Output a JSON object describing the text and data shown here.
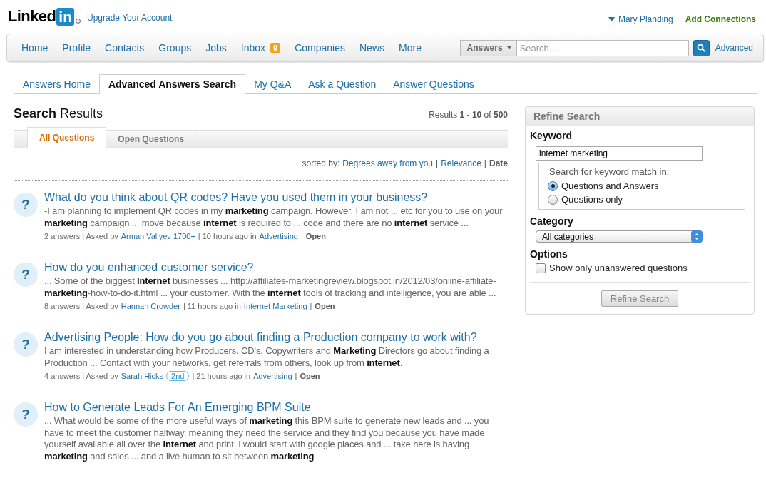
{
  "header": {
    "logo": {
      "text": "Linked",
      "badge": "in"
    },
    "upgrade_link": "Upgrade Your Account",
    "user": "Mary Planding",
    "add_connections": "Add Connections"
  },
  "nav": {
    "items": [
      {
        "label": "Home"
      },
      {
        "label": "Profile"
      },
      {
        "label": "Contacts"
      },
      {
        "label": "Groups"
      },
      {
        "label": "Jobs"
      },
      {
        "label": "Inbox",
        "badge": "9"
      },
      {
        "label": "Companies"
      },
      {
        "label": "News"
      },
      {
        "label": "More"
      }
    ],
    "search": {
      "scope": "Answers",
      "placeholder": "Search..."
    },
    "advanced_link": "Advanced"
  },
  "subtabs": [
    {
      "label": "Answers Home",
      "selected": false
    },
    {
      "label": "Advanced Answers Search",
      "selected": true
    },
    {
      "label": "My Q&A",
      "selected": false
    },
    {
      "label": "Ask a Question",
      "selected": false
    },
    {
      "label": "Answer Questions",
      "selected": false
    }
  ],
  "results": {
    "heading": "**Search** Results",
    "summary": "Results **1** - **10** of **500**",
    "tabs": [
      {
        "label": "All Questions",
        "selected": true
      },
      {
        "label": "Open Questions",
        "selected": false
      }
    ],
    "sort": [
      {
        "kind": "text",
        "text": "sorted by:"
      },
      {
        "kind": "link",
        "text": "Degrees away from you"
      },
      {
        "kind": "text",
        "text": "|"
      },
      {
        "kind": "link",
        "text": "Relevance"
      },
      {
        "kind": "text",
        "text": "|"
      },
      {
        "kind": "bold",
        "text": "Date"
      }
    ],
    "items": [
      {
        "icon": "?",
        "title": "What do you think about QR codes? Have you used them in your business?",
        "snippet": "-I am planning to implement QR codes in my **marketing** campaign. However, I am not ... etc for you to use on your **marketing** campaign ... move because **internet** is required to ... code and there are no **internet** service ...",
        "meta": [
          {
            "kind": "text",
            "text": "2 answers | Asked by"
          },
          {
            "kind": "link",
            "text": "Arman Valiyev 1700+"
          },
          {
            "kind": "text",
            "text": "| 10 hours ago in"
          },
          {
            "kind": "link",
            "text": "Advertising"
          },
          {
            "kind": "text",
            "text": "|"
          },
          {
            "kind": "bold",
            "text": "Open"
          }
        ]
      },
      {
        "icon": "?",
        "title": "How do you enhanced customer service?",
        "snippet": "... Some of the biggest **Internet** businesses ... http://affiliates-marketingreview.blogspot.in/2012/03/online-affiliate-**marketing**-how-to-do-it.html ... your customer. With the **internet** tools of tracking and intelligence, you are able ...",
        "meta": [
          {
            "kind": "text",
            "text": "8 answers | Asked by"
          },
          {
            "kind": "link",
            "text": "Hannah Crowder"
          },
          {
            "kind": "text",
            "text": "| 11 hours ago in"
          },
          {
            "kind": "link",
            "text": "Internet Marketing"
          },
          {
            "kind": "text",
            "text": "|"
          },
          {
            "kind": "bold",
            "text": "Open"
          }
        ]
      },
      {
        "icon": "?",
        "title": "Advertising People: How do you go about finding a Production company to work with?",
        "snippet": "I am interested in understanding how Producers, CD's, Copywriters and **Marketing** Directors go about finding a Production ... Contact with your networks, get referrals from others, look up from **internet**.",
        "meta": [
          {
            "kind": "text",
            "text": "4 answers | Asked by"
          },
          {
            "kind": "link",
            "text": "Sarah Hicks"
          },
          {
            "kind": "badge",
            "text": "2nd"
          },
          {
            "kind": "text",
            "text": "| 21 hours ago in"
          },
          {
            "kind": "link",
            "text": "Advertising"
          },
          {
            "kind": "text",
            "text": "|"
          },
          {
            "kind": "bold",
            "text": "Open"
          }
        ]
      },
      {
        "icon": "?",
        "title": "How to Generate Leads For An Emerging BPM Suite",
        "snippet": "... What would be some of the more useful ways of **marketing** this BPM suite to generate new leads and ... you have to meet the customer halfway, meaning they need the service and they find you because you have made yourself available all over the **internet** and print. i would start with google places and ... take here is having **marketing** and sales ... and a live human to sit between **marketing**"
      }
    ]
  },
  "refine": {
    "title": "Refine Search",
    "keyword_label": "Keyword",
    "keyword": "internet marketing",
    "match_legend": "Search for keyword match in:",
    "match_options": [
      {
        "label": "Questions and Answers",
        "selected": true
      },
      {
        "label": "Questions only",
        "selected": false
      }
    ],
    "category_label": "Category",
    "category": "All categories",
    "options_label": "Options",
    "options": [
      {
        "label": "Show only unanswered questions",
        "checked": false
      }
    ],
    "button": "Refine Search"
  }
}
